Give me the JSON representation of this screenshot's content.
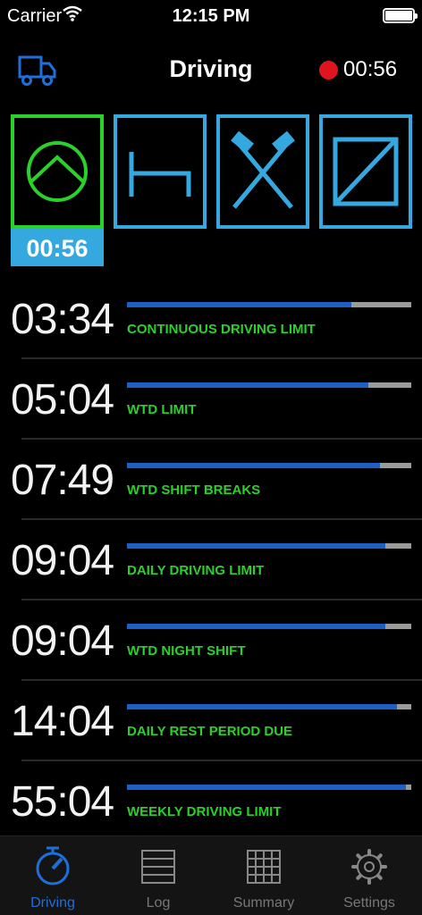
{
  "status_bar": {
    "carrier": "Carrier",
    "time": "12:15 PM",
    "icons": [
      "wifi-icon",
      "battery-icon"
    ]
  },
  "nav_bar": {
    "title": "Driving",
    "left_icon": "truck-icon",
    "recording_time": "00:56",
    "recording_color": "#e0141e"
  },
  "modes": {
    "items": [
      {
        "name": "driving",
        "icon": "steering-wheel-icon",
        "selected": true,
        "color": "#2bd12b"
      },
      {
        "name": "rest",
        "icon": "bed-icon",
        "selected": false,
        "color": "#35a8e0"
      },
      {
        "name": "other-work",
        "icon": "crossed-hammers-icon",
        "selected": false,
        "color": "#35a8e0"
      },
      {
        "name": "availability",
        "icon": "availability-icon",
        "selected": false,
        "color": "#35a8e0"
      }
    ],
    "current_timer": "00:56"
  },
  "timers": [
    {
      "time": "03:34",
      "label": "CONTINUOUS DRIVING LIMIT",
      "progress": 0.79
    },
    {
      "time": "05:04",
      "label": "WTD LIMIT",
      "progress": 0.85
    },
    {
      "time": "07:49",
      "label": "WTD SHIFT BREAKS",
      "progress": 0.89
    },
    {
      "time": "09:04",
      "label": "DAILY DRIVING LIMIT",
      "progress": 0.91
    },
    {
      "time": "09:04",
      "label": "WTD NIGHT SHIFT",
      "progress": 0.91
    },
    {
      "time": "14:04",
      "label": "DAILY REST PERIOD DUE",
      "progress": 0.95
    },
    {
      "time": "55:04",
      "label": "WEEKLY DRIVING LIMIT",
      "progress": 0.98
    }
  ],
  "tab_bar": {
    "tabs": [
      {
        "label": "Driving",
        "icon": "compass-icon",
        "active": true
      },
      {
        "label": "Log",
        "icon": "list-icon",
        "active": false
      },
      {
        "label": "Summary",
        "icon": "grid-icon",
        "active": false
      },
      {
        "label": "Settings",
        "icon": "gear-icon",
        "active": false
      }
    ]
  },
  "colors": {
    "accent_blue": "#35a8e0",
    "active_green": "#2bd12b",
    "progress_fill": "#1f5fc4",
    "tab_active": "#1f6fd8"
  }
}
